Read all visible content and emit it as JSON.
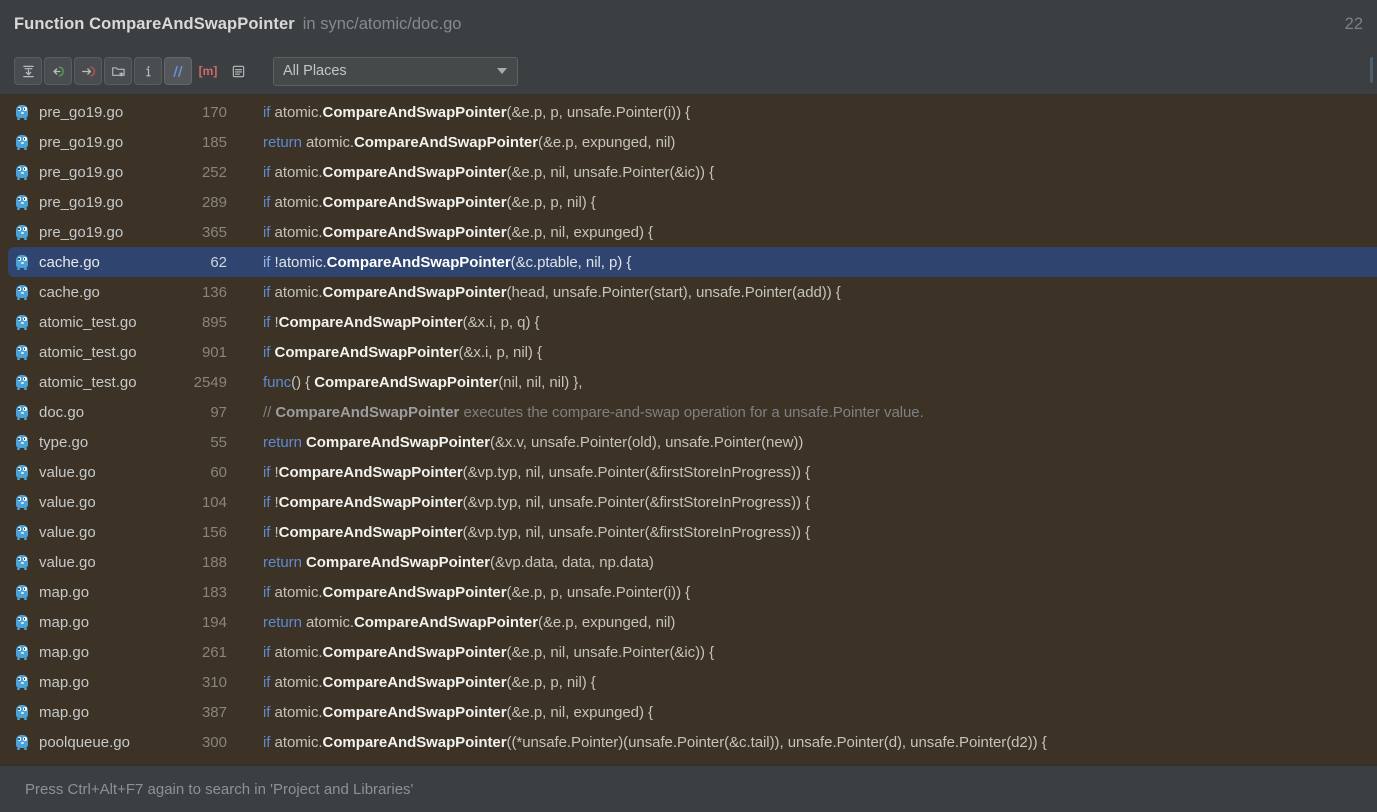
{
  "header": {
    "title_prefix": "Function",
    "title": "Function CompareAndSwapPointer",
    "subtitle": "in sync/atomic/doc.go",
    "count": "22"
  },
  "toolbar": {
    "buttons": [
      {
        "name": "expand-all-icon",
        "glyph": "expand",
        "style": "raised"
      },
      {
        "name": "previous-occurrence-icon",
        "glyph": "prev",
        "style": "raised"
      },
      {
        "name": "next-occurrence-icon",
        "glyph": "next",
        "style": "raised"
      },
      {
        "name": "group-by-directory-icon",
        "glyph": "folder-star",
        "style": "raised"
      },
      {
        "name": "show-usage-info-icon",
        "glyph": "info",
        "style": "raised"
      },
      {
        "name": "filter-comments-icon",
        "glyph": "comment-slashes",
        "style": "pressed"
      },
      {
        "name": "filter-string-literals-icon",
        "glyph": "string-m",
        "style": "flat"
      },
      {
        "name": "view-options-icon",
        "glyph": "list-lines",
        "style": "flat"
      }
    ],
    "scope_dropdown": {
      "value": "All Places",
      "placeholder": "All Places"
    }
  },
  "results": {
    "selected_index": 5,
    "rows": [
      {
        "file": "pre_go19.go",
        "line": "170",
        "parts": [
          {
            "t": "if ",
            "c": "kw"
          },
          {
            "t": "atomic.",
            "c": ""
          },
          {
            "t": "CompareAndSwapPointer",
            "c": "hit"
          },
          {
            "t": "(&e.p, p, unsafe.Pointer(i)) {",
            "c": ""
          }
        ]
      },
      {
        "file": "pre_go19.go",
        "line": "185",
        "parts": [
          {
            "t": "return ",
            "c": "kw"
          },
          {
            "t": "atomic.",
            "c": ""
          },
          {
            "t": "CompareAndSwapPointer",
            "c": "hit"
          },
          {
            "t": "(&e.p, expunged, nil)",
            "c": ""
          }
        ]
      },
      {
        "file": "pre_go19.go",
        "line": "252",
        "parts": [
          {
            "t": "if ",
            "c": "kw"
          },
          {
            "t": "atomic.",
            "c": ""
          },
          {
            "t": "CompareAndSwapPointer",
            "c": "hit"
          },
          {
            "t": "(&e.p, nil, unsafe.Pointer(&ic)) {",
            "c": ""
          }
        ]
      },
      {
        "file": "pre_go19.go",
        "line": "289",
        "parts": [
          {
            "t": "if ",
            "c": "kw"
          },
          {
            "t": "atomic.",
            "c": ""
          },
          {
            "t": "CompareAndSwapPointer",
            "c": "hit"
          },
          {
            "t": "(&e.p, p, nil) {",
            "c": ""
          }
        ]
      },
      {
        "file": "pre_go19.go",
        "line": "365",
        "parts": [
          {
            "t": "if ",
            "c": "kw"
          },
          {
            "t": "atomic.",
            "c": ""
          },
          {
            "t": "CompareAndSwapPointer",
            "c": "hit"
          },
          {
            "t": "(&e.p, nil, expunged) {",
            "c": ""
          }
        ]
      },
      {
        "file": "cache.go",
        "line": "62",
        "parts": [
          {
            "t": "if ",
            "c": "kw"
          },
          {
            "t": "!atomic.",
            "c": ""
          },
          {
            "t": "CompareAndSwapPointer",
            "c": "hit"
          },
          {
            "t": "(&c.ptable, nil, p) {",
            "c": ""
          }
        ]
      },
      {
        "file": "cache.go",
        "line": "136",
        "parts": [
          {
            "t": "if ",
            "c": "kw"
          },
          {
            "t": "atomic.",
            "c": ""
          },
          {
            "t": "CompareAndSwapPointer",
            "c": "hit"
          },
          {
            "t": "(head, unsafe.Pointer(start), unsafe.Pointer(add)) {",
            "c": ""
          }
        ]
      },
      {
        "file": "atomic_test.go",
        "line": "895",
        "parts": [
          {
            "t": "if ",
            "c": "kw"
          },
          {
            "t": "!",
            "c": ""
          },
          {
            "t": "CompareAndSwapPointer",
            "c": "hit"
          },
          {
            "t": "(&x.i, p, q) {",
            "c": ""
          }
        ]
      },
      {
        "file": "atomic_test.go",
        "line": "901",
        "parts": [
          {
            "t": "if ",
            "c": "kw"
          },
          {
            "t": "",
            "c": ""
          },
          {
            "t": "CompareAndSwapPointer",
            "c": "hit"
          },
          {
            "t": "(&x.i, p, nil) {",
            "c": ""
          }
        ]
      },
      {
        "file": "atomic_test.go",
        "line": "2549",
        "parts": [
          {
            "t": "func",
            "c": "kw"
          },
          {
            "t": "() { ",
            "c": ""
          },
          {
            "t": "CompareAndSwapPointer",
            "c": "hit"
          },
          {
            "t": "(nil, nil, nil) },",
            "c": ""
          }
        ]
      },
      {
        "file": "doc.go",
        "line": "97",
        "comment": true,
        "parts": [
          {
            "t": "// ",
            "c": "cmt"
          },
          {
            "t": "CompareAndSwapPointer",
            "c": "hit"
          },
          {
            "t": " executes the compare-and-swap operation for a unsafe.Pointer value.",
            "c": "cmt"
          }
        ]
      },
      {
        "file": "type.go",
        "line": "55",
        "parts": [
          {
            "t": "return ",
            "c": "kw"
          },
          {
            "t": "",
            "c": ""
          },
          {
            "t": "CompareAndSwapPointer",
            "c": "hit"
          },
          {
            "t": "(&x.v, unsafe.Pointer(old), unsafe.Pointer(new))",
            "c": ""
          }
        ]
      },
      {
        "file": "value.go",
        "line": "60",
        "parts": [
          {
            "t": "if ",
            "c": "kw"
          },
          {
            "t": "!",
            "c": ""
          },
          {
            "t": "CompareAndSwapPointer",
            "c": "hit"
          },
          {
            "t": "(&vp.typ, nil, unsafe.Pointer(&firstStoreInProgress)) {",
            "c": ""
          }
        ]
      },
      {
        "file": "value.go",
        "line": "104",
        "parts": [
          {
            "t": "if ",
            "c": "kw"
          },
          {
            "t": "!",
            "c": ""
          },
          {
            "t": "CompareAndSwapPointer",
            "c": "hit"
          },
          {
            "t": "(&vp.typ, nil, unsafe.Pointer(&firstStoreInProgress)) {",
            "c": ""
          }
        ]
      },
      {
        "file": "value.go",
        "line": "156",
        "parts": [
          {
            "t": "if ",
            "c": "kw"
          },
          {
            "t": "!",
            "c": ""
          },
          {
            "t": "CompareAndSwapPointer",
            "c": "hit"
          },
          {
            "t": "(&vp.typ, nil, unsafe.Pointer(&firstStoreInProgress)) {",
            "c": ""
          }
        ]
      },
      {
        "file": "value.go",
        "line": "188",
        "parts": [
          {
            "t": "return ",
            "c": "kw"
          },
          {
            "t": "",
            "c": ""
          },
          {
            "t": "CompareAndSwapPointer",
            "c": "hit"
          },
          {
            "t": "(&vp.data, data, np.data)",
            "c": ""
          }
        ]
      },
      {
        "file": "map.go",
        "line": "183",
        "parts": [
          {
            "t": "if ",
            "c": "kw"
          },
          {
            "t": "atomic.",
            "c": ""
          },
          {
            "t": "CompareAndSwapPointer",
            "c": "hit"
          },
          {
            "t": "(&e.p, p, unsafe.Pointer(i)) {",
            "c": ""
          }
        ]
      },
      {
        "file": "map.go",
        "line": "194",
        "parts": [
          {
            "t": "return ",
            "c": "kw"
          },
          {
            "t": "atomic.",
            "c": ""
          },
          {
            "t": "CompareAndSwapPointer",
            "c": "hit"
          },
          {
            "t": "(&e.p, expunged, nil)",
            "c": ""
          }
        ]
      },
      {
        "file": "map.go",
        "line": "261",
        "parts": [
          {
            "t": "if ",
            "c": "kw"
          },
          {
            "t": "atomic.",
            "c": ""
          },
          {
            "t": "CompareAndSwapPointer",
            "c": "hit"
          },
          {
            "t": "(&e.p, nil, unsafe.Pointer(&ic)) {",
            "c": ""
          }
        ]
      },
      {
        "file": "map.go",
        "line": "310",
        "parts": [
          {
            "t": "if ",
            "c": "kw"
          },
          {
            "t": "atomic.",
            "c": ""
          },
          {
            "t": "CompareAndSwapPointer",
            "c": "hit"
          },
          {
            "t": "(&e.p, p, nil) {",
            "c": ""
          }
        ]
      },
      {
        "file": "map.go",
        "line": "387",
        "parts": [
          {
            "t": "if ",
            "c": "kw"
          },
          {
            "t": "atomic.",
            "c": ""
          },
          {
            "t": "CompareAndSwapPointer",
            "c": "hit"
          },
          {
            "t": "(&e.p, nil, expunged) {",
            "c": ""
          }
        ]
      },
      {
        "file": "poolqueue.go",
        "line": "300",
        "parts": [
          {
            "t": "if ",
            "c": "kw"
          },
          {
            "t": "atomic.",
            "c": ""
          },
          {
            "t": "CompareAndSwapPointer",
            "c": "hit"
          },
          {
            "t": "((*unsafe.Pointer)(unsafe.Pointer(&c.tail)), unsafe.Pointer(d), unsafe.Pointer(d2)) {",
            "c": ""
          }
        ]
      }
    ]
  },
  "statusbar": {
    "message": "Press Ctrl+Alt+F7 again to search in 'Project and Libraries'"
  },
  "colors": {
    "results_bg": "#3c3226",
    "selection_bg": "#2f4570",
    "chrome_bg": "#3c3f41",
    "keyword": "#5e8ad0",
    "match": "#f2f2ee"
  }
}
